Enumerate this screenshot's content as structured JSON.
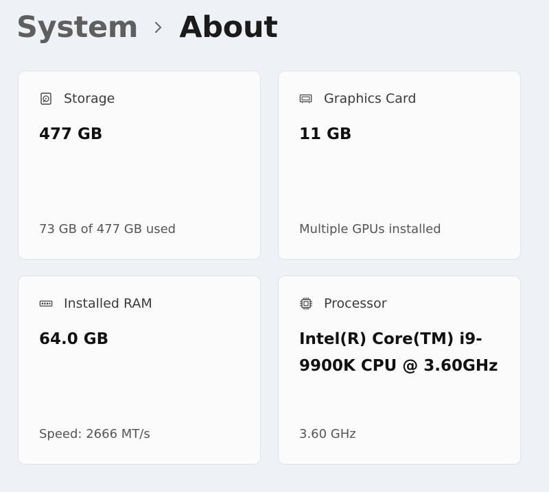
{
  "breadcrumb": {
    "parent": "System",
    "current": "About"
  },
  "cards": {
    "storage": {
      "icon": "hard-drive-icon",
      "title": "Storage",
      "value": "477 GB",
      "detail": "73 GB of 477 GB used"
    },
    "graphics": {
      "icon": "graphics-card-icon",
      "title": "Graphics Card",
      "value": "11 GB",
      "detail": "Multiple GPUs installed"
    },
    "ram": {
      "icon": "memory-module-icon",
      "title": "Installed RAM",
      "value": "64.0 GB",
      "detail": "Speed: 2666 MT/s"
    },
    "cpu": {
      "icon": "processor-chip-icon",
      "title": "Processor",
      "value": "Intel(R) Core(TM) i9-9900K CPU @ 3.60GHz",
      "detail": "3.60 GHz"
    }
  },
  "icons": {
    "breadcrumb_separator": "chevron-right-icon"
  }
}
